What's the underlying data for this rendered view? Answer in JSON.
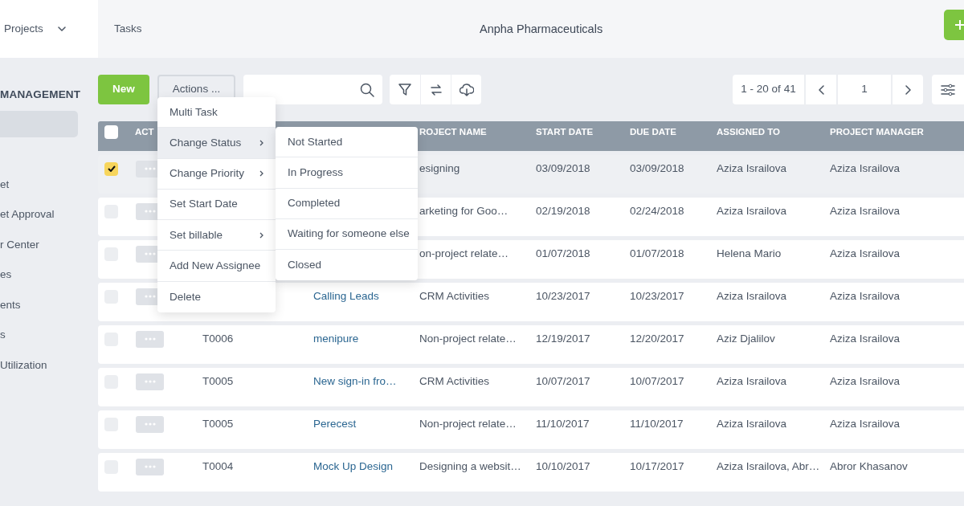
{
  "sidebar": {
    "header": {
      "label": "Projects"
    },
    "section": "MANAGEMENT",
    "items": [
      {
        "selected": true
      },
      {
        "label": "et",
        "selected": false
      },
      {
        "label": "et Approval",
        "selected": false
      },
      {
        "label": "r Center",
        "selected": false
      },
      {
        "label": "es",
        "selected": false
      },
      {
        "label": "ents",
        "selected": false
      },
      {
        "label": "s",
        "selected": false
      },
      {
        "label": "Utilization",
        "selected": false
      }
    ]
  },
  "topbar": {
    "breadcrumb": "Tasks",
    "title": "Anpha Pharmaceuticals"
  },
  "toolbar": {
    "new_button": "New",
    "actions_button": "Actions ...",
    "pagination": {
      "range": "1 - 20 of 41",
      "page": "1"
    }
  },
  "actions_menu": [
    {
      "label": "Multi Task",
      "submenu": false,
      "selected": false
    },
    {
      "label": "Change Status",
      "submenu": true,
      "selected": true
    },
    {
      "label": "Change Priority",
      "submenu": true,
      "selected": false
    },
    {
      "label": "Set Start Date",
      "submenu": false,
      "selected": false
    },
    {
      "label": "Set billable",
      "submenu": true,
      "selected": false
    },
    {
      "label": "Add New Assignee",
      "submenu": false,
      "selected": false
    },
    {
      "label": "Delete",
      "submenu": false,
      "selected": false
    }
  ],
  "status_submenu": [
    "Not Started",
    "In Progress",
    "Completed",
    "Waiting for someone else",
    "Closed"
  ],
  "table": {
    "header_checked": false,
    "columns": [
      {
        "kind": "action",
        "label": "ACT"
      },
      {
        "kind": "text"
      },
      {
        "kind": "link"
      },
      {
        "kind": "text",
        "label": "ROJECT NAME"
      },
      {
        "kind": "text",
        "label": "START DATE"
      },
      {
        "kind": "text",
        "label": "DUE DATE"
      },
      {
        "kind": "text",
        "label": "ASSIGNED TO"
      },
      {
        "kind": "text",
        "label": "PROJECT MANAGER"
      }
    ],
    "rows": [
      {
        "checked": true,
        "selected": true,
        "project": "esigning",
        "start": "03/09/2018",
        "due": "03/09/2018",
        "assigned": "Aziza Israilova",
        "manager": "Aziza Israilova"
      },
      {
        "checked": false,
        "selected": false,
        "project": "arketing for Goo…",
        "start": "02/19/2018",
        "due": "02/24/2018",
        "assigned": "Aziza Israilova",
        "manager": "Aziza Israilova"
      },
      {
        "checked": false,
        "selected": false,
        "project": "on-project relate…",
        "start": "01/07/2018",
        "due": "01/07/2018",
        "assigned": "Helena Mario",
        "manager": "Aziza Israilova"
      },
      {
        "checked": false,
        "selected": false,
        "task": "Calling Leads",
        "project": "CRM Activities",
        "start": "10/23/2017",
        "due": "10/23/2017",
        "assigned": "Aziza Israilova",
        "manager": "Aziza Israilova"
      },
      {
        "checked": false,
        "selected": false,
        "id": "T0006",
        "task": "menipure",
        "project": "Non-project relate…",
        "start": "12/19/2017",
        "due": "12/20/2017",
        "assigned": "Aziz Djalilov",
        "manager": "Aziza Israilova"
      },
      {
        "checked": false,
        "selected": false,
        "id": "T0005",
        "task": "New sign-in fro…",
        "project": "CRM Activities",
        "start": "10/07/2017",
        "due": "10/07/2017",
        "assigned": "Aziza Israilova",
        "manager": "Aziza Israilova"
      },
      {
        "checked": false,
        "selected": false,
        "id": "T0005",
        "task": "Perecest",
        "project": "Non-project relate…",
        "start": "11/10/2017",
        "due": "11/10/2017",
        "assigned": "Aziza Israilova",
        "manager": "Aziza Israilova"
      },
      {
        "checked": false,
        "selected": false,
        "id": "T0004",
        "task": "Mock Up Design",
        "project": "Designing a websit…",
        "start": "10/10/2017",
        "due": "10/17/2017",
        "assigned": "Aziza Israilova, Abr…",
        "manager": "Abror Khasanov"
      }
    ]
  }
}
